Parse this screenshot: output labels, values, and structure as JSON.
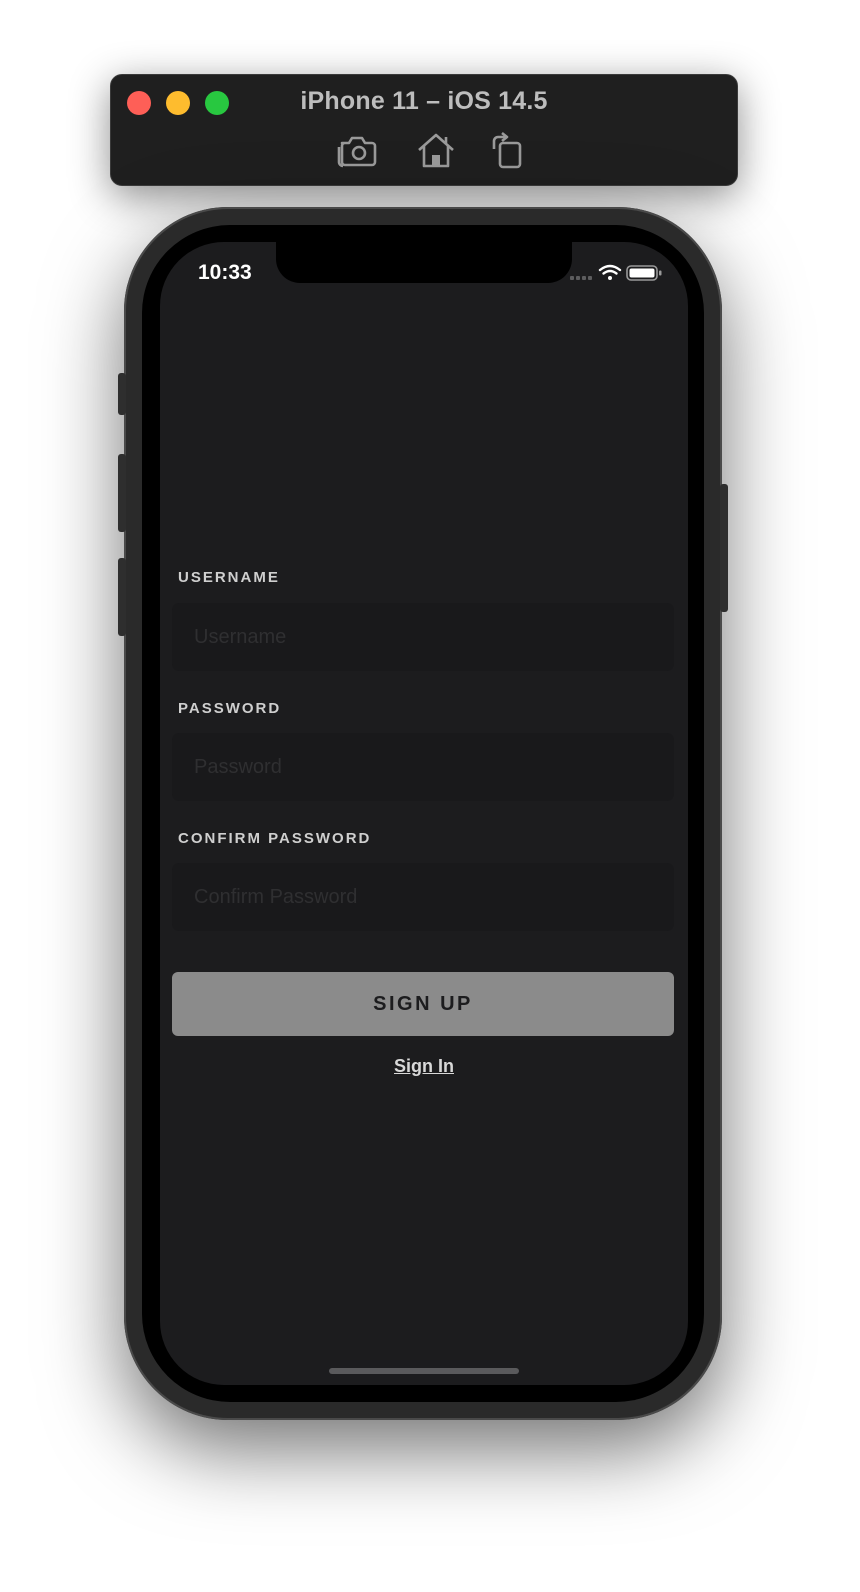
{
  "simulator": {
    "title": "iPhone 11 – iOS 14.5",
    "tools": [
      {
        "icon": "screenshot-camera-icon"
      },
      {
        "icon": "home-icon"
      },
      {
        "icon": "rotate-icon"
      }
    ],
    "window_buttons": [
      "close",
      "minimize",
      "zoom"
    ]
  },
  "status_bar": {
    "time": "10:33",
    "icons": [
      "cellular-signal-icon",
      "wifi-icon",
      "battery-icon"
    ]
  },
  "form": {
    "username": {
      "label": "USERNAME",
      "placeholder": "Username",
      "value": ""
    },
    "password": {
      "label": "PASSWORD",
      "placeholder": "Password",
      "value": ""
    },
    "confirm_password": {
      "label": "CONFIRM PASSWORD",
      "placeholder": "Confirm Password",
      "value": ""
    },
    "submit_label": "SIGN UP",
    "signin_link": "Sign In"
  },
  "colors": {
    "screen_bg": "#1c1c1e",
    "input_bg": "#19191b",
    "button_bg": "#8b8b8b",
    "label_color": "#cfcfcf"
  }
}
